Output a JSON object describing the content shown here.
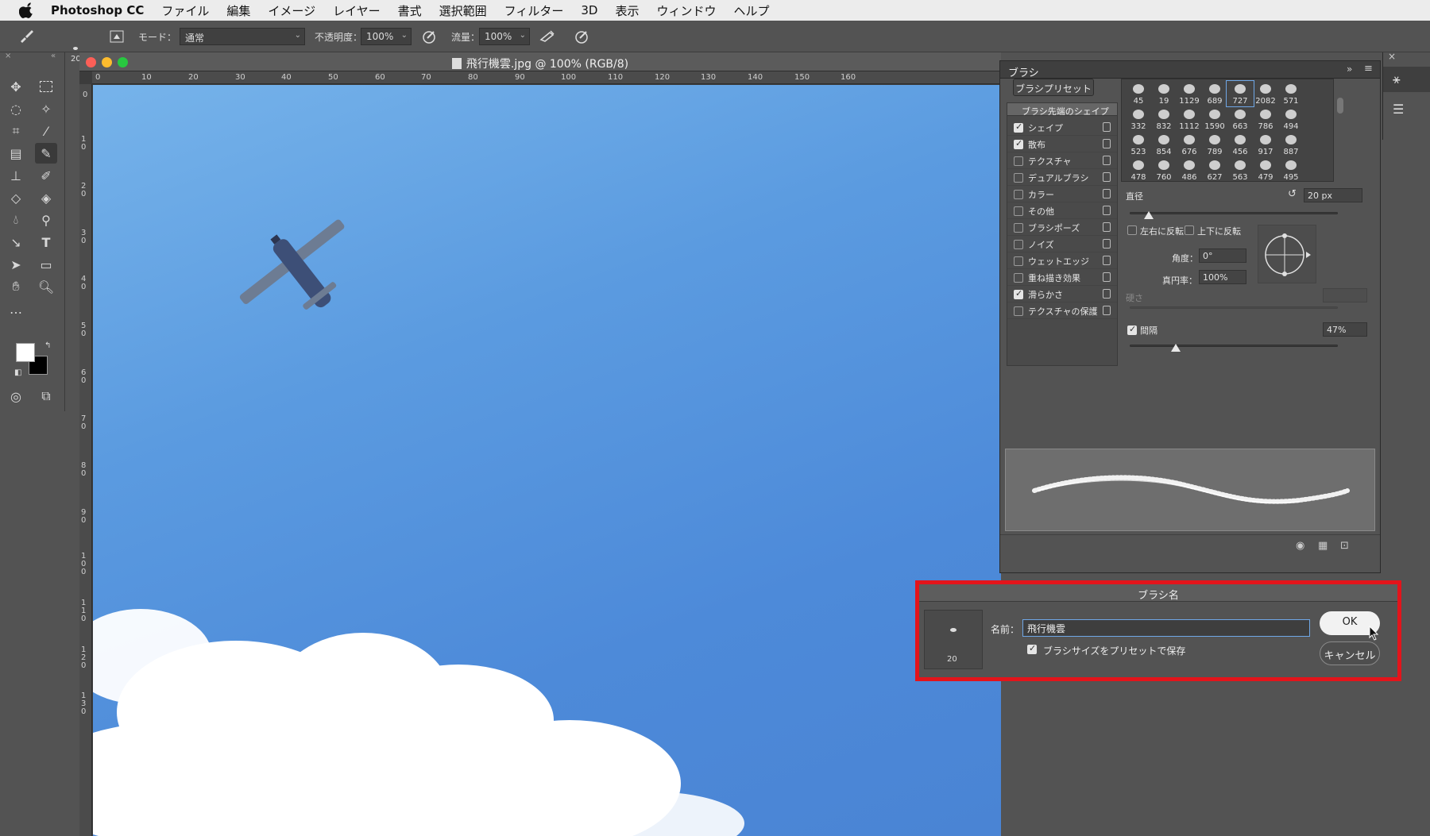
{
  "menubar": {
    "app_name": "Photoshop CC",
    "items": [
      "ファイル",
      "編集",
      "イメージ",
      "レイヤー",
      "書式",
      "選択範囲",
      "フィルター",
      "3D",
      "表示",
      "ウィンドウ",
      "ヘルプ"
    ]
  },
  "options": {
    "brush_size": "20",
    "mode_label": "モード：",
    "mode_value": "通常",
    "opacity_label": "不透明度：",
    "opacity_value": "100%",
    "flow_label": "流量：",
    "flow_value": "100%"
  },
  "document": {
    "title": "飛行機雲.jpg @ 100% (RGB/8)",
    "ruler_top": [
      "0",
      "10",
      "20",
      "30",
      "40",
      "50",
      "60",
      "70",
      "80",
      "90",
      "100",
      "110",
      "120",
      "130",
      "140",
      "150",
      "160"
    ],
    "ruler_left": [
      "0",
      "1 0",
      "2 0",
      "3 0",
      "4 0",
      "5 0",
      "6 0",
      "7 0",
      "8 0",
      "9 0",
      "1 0 0",
      "1 1 0",
      "1 2 0",
      "1 3 0"
    ]
  },
  "brush_panel": {
    "tab": "ブラシ",
    "presets_button": "ブラシプリセット",
    "tip_shape_header": "ブラシ先端のシェイプ",
    "options": [
      {
        "label": "シェイプ",
        "checked": true
      },
      {
        "label": "散布",
        "checked": true
      },
      {
        "label": "テクスチャ",
        "checked": false
      },
      {
        "label": "デュアルブラシ",
        "checked": false
      },
      {
        "label": "カラー",
        "checked": false
      },
      {
        "label": "その他",
        "checked": false
      },
      {
        "label": "ブラシポーズ",
        "checked": false
      },
      {
        "label": "ノイズ",
        "checked": false
      },
      {
        "label": "ウェットエッジ",
        "checked": false
      },
      {
        "label": "重ね描き効果",
        "checked": false
      },
      {
        "label": "滑らかさ",
        "checked": true
      },
      {
        "label": "テクスチャの保護",
        "checked": false
      }
    ],
    "tips": [
      "45",
      "19",
      "1129",
      "689",
      "727",
      "2082",
      "571",
      "332",
      "832",
      "1112",
      "1590",
      "663",
      "786",
      "494",
      "523",
      "854",
      "676",
      "789",
      "456",
      "917",
      "887",
      "478",
      "760",
      "486",
      "627",
      "563",
      "479",
      "495"
    ],
    "selected_tip": "727",
    "diameter_label": "直径",
    "diameter_value": "20 px",
    "diameter_fraction": 0.09,
    "flip_x_label": "左右に反転",
    "flip_y_label": "上下に反転",
    "angle_label": "角度：",
    "angle_value": "0°",
    "roundness_label": "真円率：",
    "roundness_value": "100%",
    "hardness_label": "硬さ",
    "spacing_label": "間隔",
    "spacing_value": "47%",
    "spacing_fraction": 0.22
  },
  "dialog": {
    "title": "ブラシ名",
    "name_label": "名前：",
    "name_value": "飛行機雲",
    "thumb_size": "20",
    "save_size_label": "ブラシサイズをプリセットで保存",
    "save_size_checked": true,
    "ok_label": "OK",
    "cancel_label": "キャンセル"
  },
  "colors": {
    "highlight_frame": "#e3141b",
    "panel_bg": "#535353",
    "sky": "#5b9be0"
  }
}
